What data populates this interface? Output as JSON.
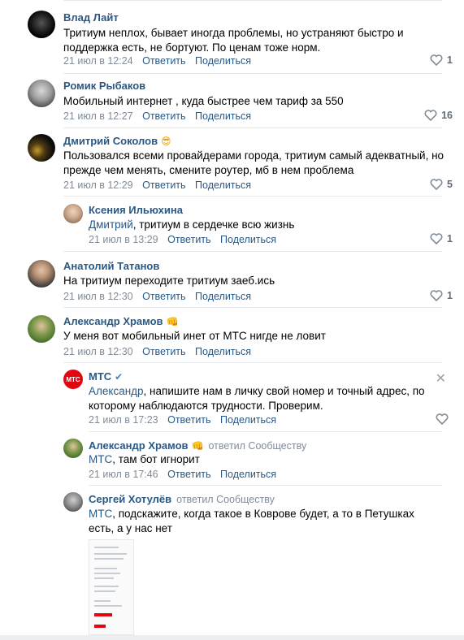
{
  "comments": [
    {
      "author": "Влад Лайт",
      "text": "Тритиум неплох, бывает иногда проблемы, но устраняют быстро и поддержка есть, не бортуют. По ценам тоже норм.",
      "date": "21 июл в 12:24",
      "reply": "Ответить",
      "share": "Поделиться",
      "likes": "1"
    },
    {
      "author": "Ромик Рыбаков",
      "text": "Мобильный интернет , куда быстрее чем тариф за 550",
      "date": "21 июл в 12:27",
      "reply": "Ответить",
      "share": "Поделиться",
      "likes": "16"
    },
    {
      "author": "Дмитрий Соколов",
      "emoji": "😎",
      "text": "Пользовался всеми провайдерами города, тритиум самый адекватный, но прежде чем менять, смените роутер, мб в нем проблема",
      "date": "21 июл в 12:29",
      "reply": "Ответить",
      "share": "Поделиться",
      "likes": "5"
    },
    {
      "author": "Ксения Ильюхина",
      "mention": "Дмитрий",
      "text": ", тритиум в сердечке всю жизнь",
      "date": "21 июл в 13:29",
      "reply": "Ответить",
      "share": "Поделиться",
      "likes": "1"
    },
    {
      "author": "Анатолий Татанов",
      "text": "На тритиум переходите тритиум заеб.ись",
      "date": "21 июл в 12:30",
      "reply": "Ответить",
      "share": "Поделиться",
      "likes": "1"
    },
    {
      "author": "Александр Храмов",
      "emoji": "👊",
      "text": "У меня вот мобильный инет от МТС нигде не ловит",
      "date": "21 июл в 12:30",
      "reply": "Ответить",
      "share": "Поделиться"
    },
    {
      "author": "МТС",
      "verified": "✔",
      "mention": "Александр",
      "text": ", напишите нам в личку свой номер и точный адрес, по которому наблюдаются трудности. Проверим.",
      "date": "21 июл в 17:23",
      "reply": "Ответить",
      "share": "Поделиться",
      "close": "✕"
    },
    {
      "author": "Александр Храмов",
      "emoji": "👊",
      "replied": "ответил Сообществу",
      "mention": "МТС",
      "text": ", там бот игнорит",
      "date": "21 июл в 17:46",
      "reply": "Ответить",
      "share": "Поделиться"
    },
    {
      "author": "Сергей Хотулёв",
      "replied": "ответил Сообществу",
      "mention": "МТС",
      "text": ", подскажите, когда такое в Коврове будет, а то в Петушках есть, а у нас нет"
    }
  ],
  "mts_logo_text": "МТС",
  "colors": {
    "link": "#2a5885",
    "meta": "#818c99",
    "mts_red": "#e30611",
    "separator": "#e7e8ec"
  }
}
